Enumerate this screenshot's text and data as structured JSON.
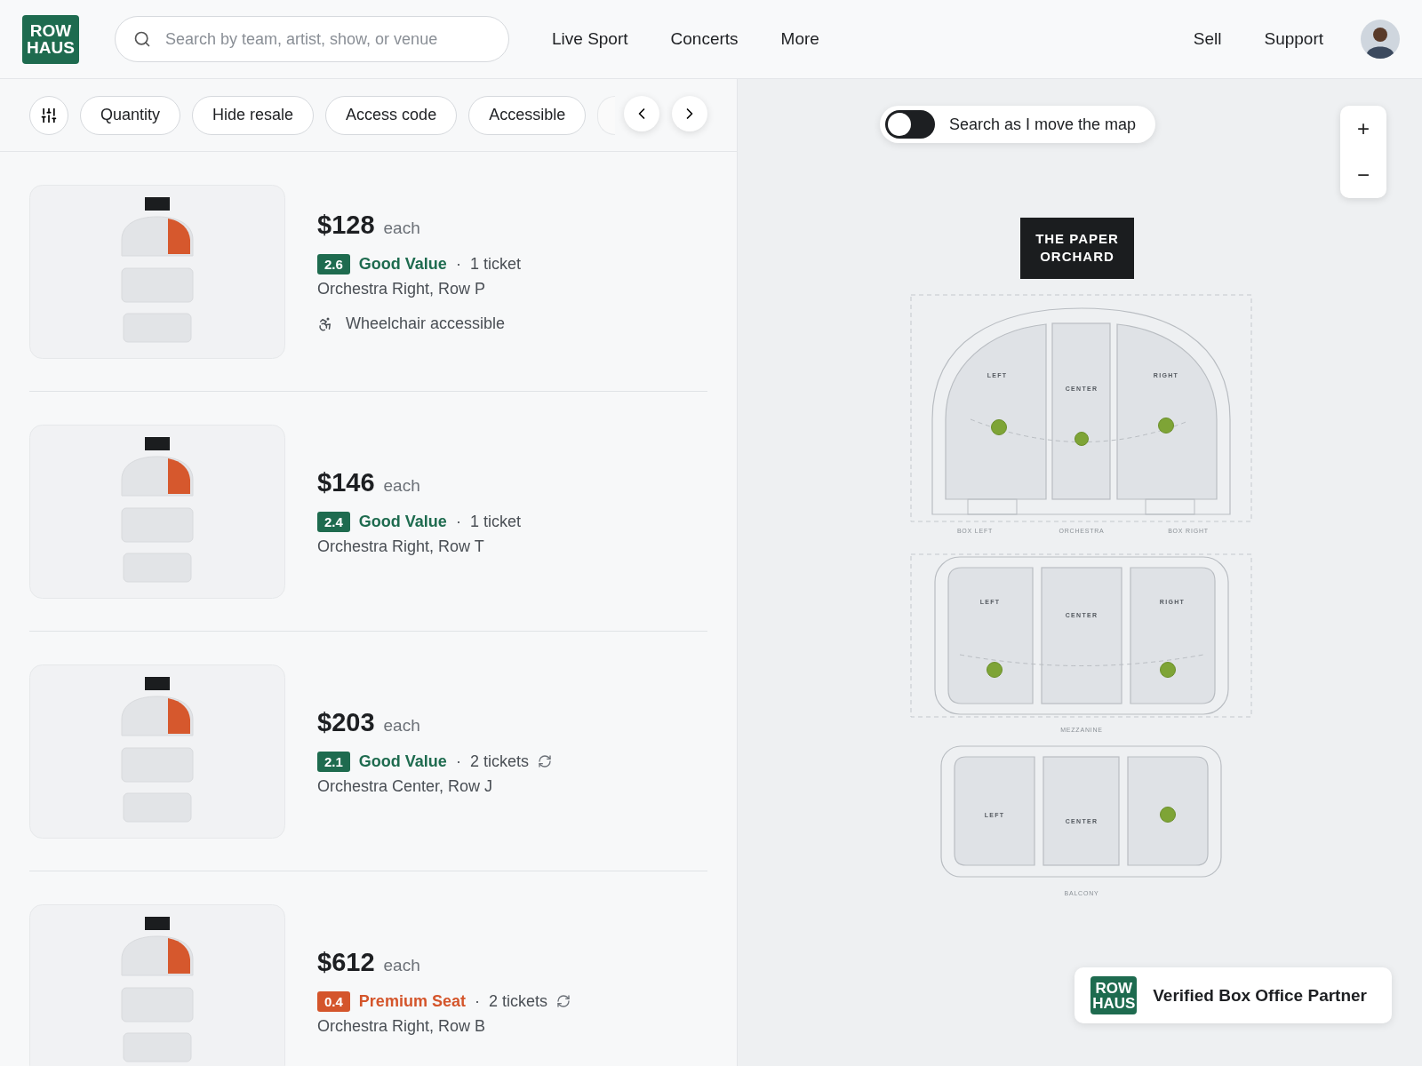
{
  "header": {
    "logo": [
      "ROW",
      "HAUS"
    ],
    "search": {
      "placeholder": "Search by team, artist, show, or venue"
    },
    "nav": [
      "Live Sport",
      "Concerts",
      "More"
    ],
    "links": [
      "Sell",
      "Support"
    ]
  },
  "filters": {
    "chips": [
      {
        "label": "Quantity"
      },
      {
        "label": "Hide resale"
      },
      {
        "label": "Access code"
      },
      {
        "label": "Accessible"
      }
    ]
  },
  "listings": [
    {
      "price": "$128",
      "unit": "each",
      "score": "2.6",
      "color": "#1e6b4f",
      "rating": "Good Value",
      "sep": "·",
      "quantity": "1 ticket",
      "resale": false,
      "seat": "Orchestra Right, Row P",
      "feature": "Wheelchair accessible"
    },
    {
      "price": "$146",
      "unit": "each",
      "score": "2.4",
      "color": "#1e6b4f",
      "rating": "Good Value",
      "sep": "·",
      "quantity": "1 ticket",
      "resale": false,
      "seat": "Orchestra Right, Row T"
    },
    {
      "price": "$203",
      "unit": "each",
      "score": "2.1",
      "color": "#1e6b4f",
      "rating": "Good Value",
      "sep": "·",
      "quantity": "2 tickets",
      "resale": true,
      "seat": "Orchestra Center, Row J"
    },
    {
      "price": "$612",
      "unit": "each",
      "score": "0.4",
      "color": "#d4552b",
      "rating": "Premium Seat",
      "sep": "·",
      "quantity": "2 tickets",
      "resale": true,
      "seat": "Orchestra Right, Row B"
    }
  ],
  "map": {
    "toggle": {
      "label": "Search as I move the map",
      "on": false
    },
    "zoom_in": "+",
    "zoom_out": "−",
    "venue": [
      "THE PAPER",
      "ORCHARD"
    ],
    "orchestra": {
      "sections": [
        "LEFT",
        "CENTER",
        "RIGHT"
      ],
      "boxes": [
        "BOX LEFT",
        "ORCHESTRA",
        "BOX RIGHT"
      ]
    },
    "mezzanine": {
      "sections": [
        "LEFT",
        "CENTER",
        "RIGHT"
      ],
      "name": "MEZZANINE"
    },
    "balcony": {
      "sections": [
        "LEFT",
        "CENTER"
      ],
      "name": "BALCONY"
    },
    "partner": {
      "logo": [
        "ROW",
        "HAUS"
      ],
      "text": "Verified Box Office Partner"
    }
  }
}
